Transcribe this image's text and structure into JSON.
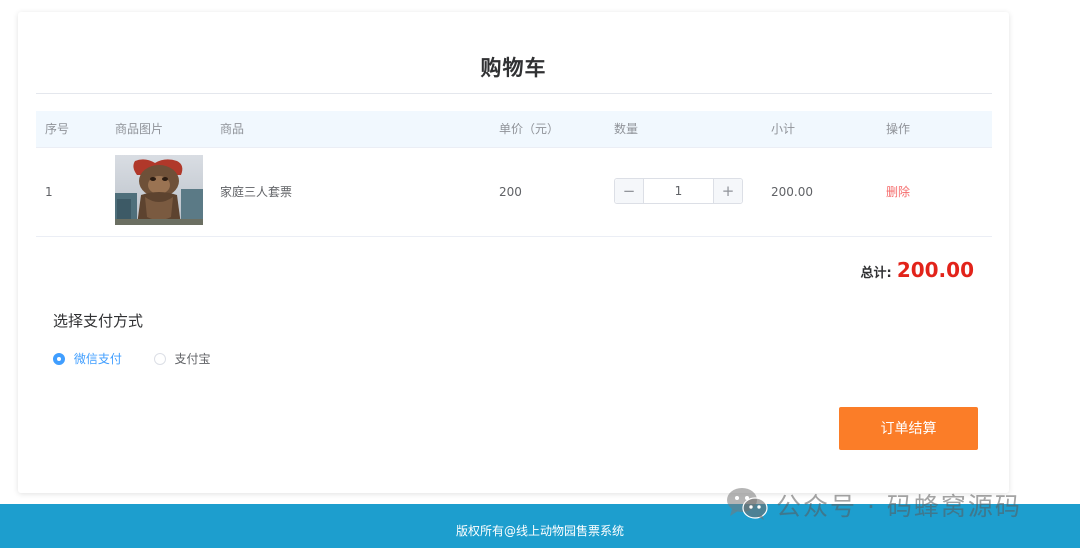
{
  "page": {
    "title": "购物车"
  },
  "table": {
    "headers": {
      "seq": "序号",
      "image": "商品图片",
      "name": "商品",
      "price": "单价（元）",
      "quantity": "数量",
      "subtotal": "小计",
      "action": "操作"
    },
    "rows": [
      {
        "seq": "1",
        "name": "家庭三人套票",
        "price": "200",
        "quantity": "1",
        "subtotal": "200.00",
        "action": "删除"
      }
    ]
  },
  "stepper": {
    "minus": "−",
    "plus": "+"
  },
  "total": {
    "label": "总计:",
    "value": "200.00"
  },
  "payment": {
    "title": "选择支付方式",
    "options": [
      {
        "label": "微信支付",
        "checked": true
      },
      {
        "label": "支付宝",
        "checked": false
      }
    ]
  },
  "checkout": {
    "label": "订单结算"
  },
  "footer": {
    "copyright": "版权所有@线上动物园售票系统"
  },
  "watermark": {
    "text": "公众号 · 码蜂窝源码"
  },
  "colors": {
    "accent": "#409eff",
    "checkout": "#fb7d28",
    "total": "#e2231a",
    "delete": "#f56c6c",
    "footer": "#1d9ece",
    "header_row": "#f1f8fe"
  },
  "icons": {
    "minus": "minus-icon",
    "plus": "plus-icon",
    "product_image": "monkey-statue-image",
    "watermark": "wechat-icon"
  }
}
